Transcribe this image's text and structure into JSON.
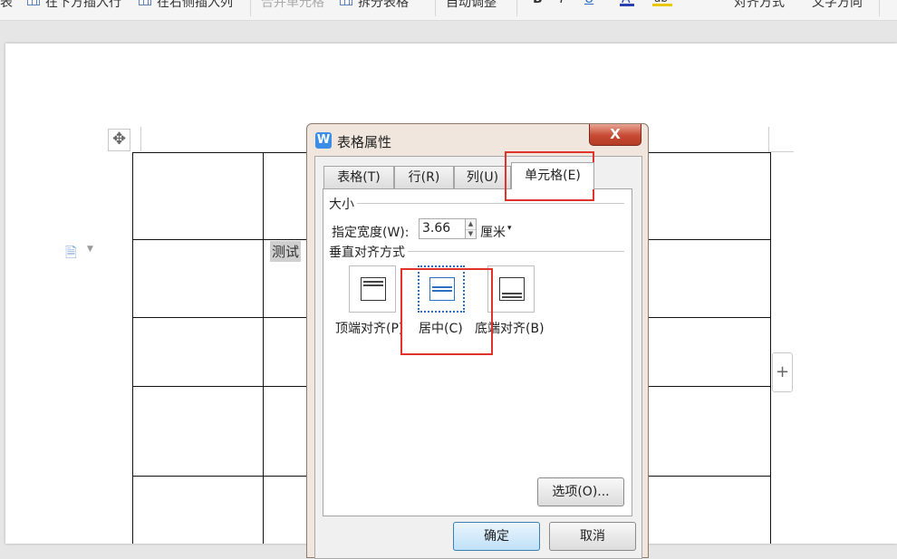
{
  "toolbar": {
    "item_left_cut": "表",
    "insert_row_below": "在下方插入行",
    "insert_col_right": "在右侧插入列",
    "merge_cells": "合并单元格",
    "split_table": "拆分表格",
    "auto_adjust": "自动调整",
    "bold": "B",
    "italic": "I",
    "underline": "U",
    "font_color": "A",
    "highlight": "ab",
    "alignment": "对齐方式",
    "text_direction": "文字方向"
  },
  "document": {
    "cell_text": "测试",
    "move_handle_icon": "move-arrows-icon",
    "add_column_label": "+"
  },
  "dialog": {
    "title": "表格属性",
    "app_icon": "W",
    "close_label": "X",
    "tabs": [
      {
        "label": "表格(T)"
      },
      {
        "label": "行(R)"
      },
      {
        "label": "列(U)"
      },
      {
        "label": "单元格(E)",
        "active": true
      }
    ],
    "size_group": "大小",
    "width_label": "指定宽度(W):",
    "width_value": "3.66",
    "width_unit": "厘米",
    "valign_group": "垂直对齐方式",
    "valign_options": [
      {
        "label": "顶端对齐(P)"
      },
      {
        "label": "居中(C)",
        "selected": true
      },
      {
        "label": "底端对齐(B)"
      }
    ],
    "options_button": "选项(O)...",
    "ok_button": "确定",
    "cancel_button": "取消"
  },
  "colors": {
    "accent": "#2f6fc1",
    "annotation_red": "#e0332b",
    "close_red": "#c74a33"
  }
}
